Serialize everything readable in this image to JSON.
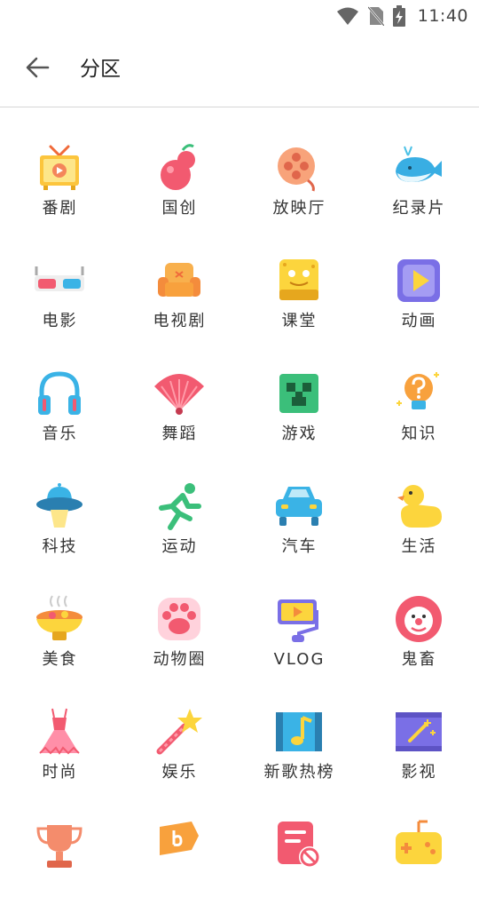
{
  "status_bar": {
    "time": "11:40"
  },
  "header": {
    "title": "分区"
  },
  "categories": [
    {
      "label": "番剧",
      "icon": "tv-icon"
    },
    {
      "label": "国创",
      "icon": "gourd-icon"
    },
    {
      "label": "放映厅",
      "icon": "film-reel-icon"
    },
    {
      "label": "纪录片",
      "icon": "whale-icon"
    },
    {
      "label": "电影",
      "icon": "3d-glasses-icon"
    },
    {
      "label": "电视剧",
      "icon": "sofa-icon"
    },
    {
      "label": "课堂",
      "icon": "sponge-icon"
    },
    {
      "label": "动画",
      "icon": "play-square-icon"
    },
    {
      "label": "音乐",
      "icon": "headphones-icon"
    },
    {
      "label": "舞蹈",
      "icon": "fan-icon"
    },
    {
      "label": "游戏",
      "icon": "creeper-icon"
    },
    {
      "label": "知识",
      "icon": "lightbulb-icon"
    },
    {
      "label": "科技",
      "icon": "ufo-icon"
    },
    {
      "label": "运动",
      "icon": "runner-icon"
    },
    {
      "label": "汽车",
      "icon": "car-icon"
    },
    {
      "label": "生活",
      "icon": "duck-icon"
    },
    {
      "label": "美食",
      "icon": "hotpot-icon"
    },
    {
      "label": "动物圈",
      "icon": "paw-icon"
    },
    {
      "label": "VLOG",
      "icon": "camera-icon"
    },
    {
      "label": "鬼畜",
      "icon": "clown-icon"
    },
    {
      "label": "时尚",
      "icon": "dress-icon"
    },
    {
      "label": "娱乐",
      "icon": "magic-wand-icon"
    },
    {
      "label": "新歌热榜",
      "icon": "music-note-icon"
    },
    {
      "label": "影视",
      "icon": "film-strip-icon"
    },
    {
      "label": "",
      "icon": "trophy-icon"
    },
    {
      "label": "",
      "icon": "flag-icon"
    },
    {
      "label": "",
      "icon": "no-sign-icon"
    },
    {
      "label": "",
      "icon": "gamepad-icon"
    }
  ]
}
